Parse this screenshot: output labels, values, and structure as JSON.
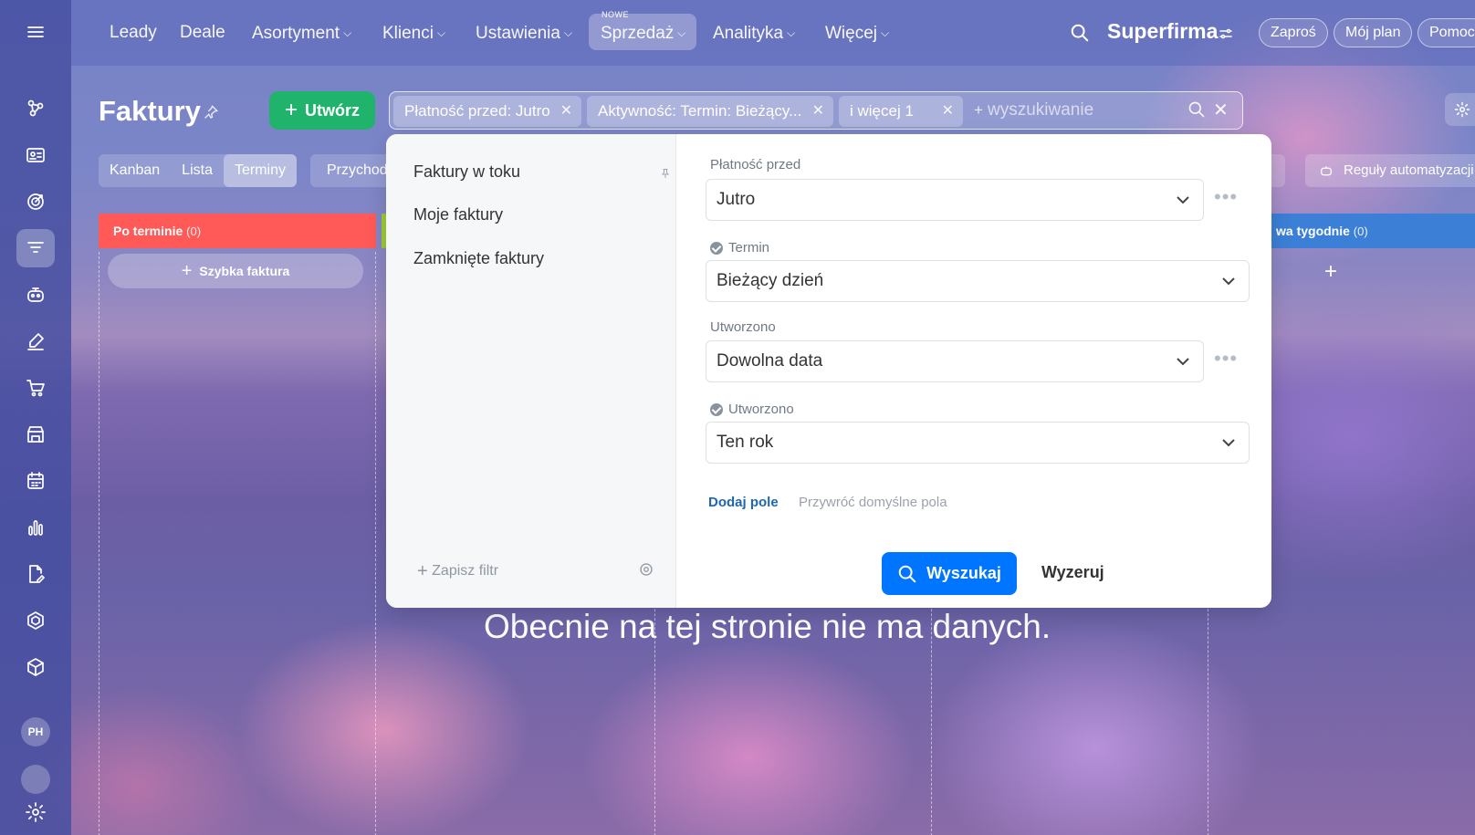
{
  "topnav": {
    "items": [
      {
        "label": "Leady",
        "has_dropdown": false
      },
      {
        "label": "Deale",
        "has_dropdown": false
      },
      {
        "label": "Asortyment",
        "has_dropdown": true
      },
      {
        "label": "Klienci",
        "has_dropdown": true
      },
      {
        "label": "Ustawienia",
        "has_dropdown": true
      },
      {
        "label": "Sprzedaż",
        "has_dropdown": true,
        "active": true,
        "badge": "NOWE"
      },
      {
        "label": "Analityka",
        "has_dropdown": true
      },
      {
        "label": "Więcej",
        "has_dropdown": true
      }
    ],
    "brand": "Superfirma",
    "invite": "Zaproś",
    "my_plan": "Mój plan",
    "help": "Pomoc"
  },
  "sidebar": {
    "icons": [
      "users-network-icon",
      "contact-card-icon",
      "target-icon",
      "filter-funnel-icon",
      "robot-icon",
      "sign-pen-icon",
      "cart-icon",
      "store-icon",
      "calendar-grid-icon",
      "bar-chart-icon",
      "document-edit-icon",
      "hexagon-icon",
      "box-icon"
    ],
    "active_index": 3,
    "avatar_initials": "PH"
  },
  "page": {
    "title": "Faktury",
    "create_label": "Utwórz",
    "views": [
      "Kanban",
      "Lista",
      "Terminy"
    ],
    "active_view": "Terminy",
    "incoming_label": "Przychod",
    "automation_label": "Reguły automatyzacji"
  },
  "search": {
    "chips": [
      "Płatność przed: Jutro",
      "Aktywność: Termin: Bieżący...",
      "i więcej 1"
    ],
    "placeholder": "wyszukiwanie"
  },
  "columns": {
    "overdue": {
      "label": "Po terminie",
      "count": "(0)"
    },
    "two_weeks": {
      "label": "wa tygodnie",
      "count": "(0)"
    },
    "quick_invoice": "Szybka faktura"
  },
  "empty_message": "Obecnie na tej stronie nie ma danych.",
  "filter_popup": {
    "presets": [
      "Faktury w toku",
      "Moje faktury",
      "Zamknięte faktury"
    ],
    "save_filter": "Zapisz filtr",
    "fields": [
      {
        "label": "Płatność przed",
        "value": "Jutro",
        "checked": false
      },
      {
        "label": "Termin",
        "value": "Bieżący dzień",
        "checked": true
      },
      {
        "label": "Utworzono",
        "value": "Dowolna data",
        "checked": false
      },
      {
        "label": "Utworzono",
        "value": "Ten rok",
        "checked": true
      }
    ],
    "add_field": "Dodaj pole",
    "restore_fields": "Przywróć domyślne pola",
    "search_button": "Wyszukaj",
    "reset_button": "Wyzeruj"
  },
  "colors": {
    "overdue_column": "#ff5a57",
    "two_weeks_column": "#3b7fd6",
    "create_button": "#1fb36b",
    "search_button": "#0075ff",
    "link": "#2067b0"
  }
}
